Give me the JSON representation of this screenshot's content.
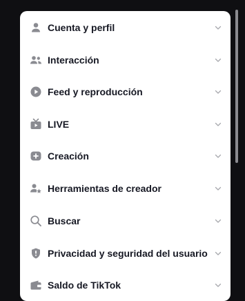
{
  "menu": {
    "items": [
      {
        "label": "Cuenta y perfil",
        "icon": "person-icon"
      },
      {
        "label": "Interacción",
        "icon": "people-icon"
      },
      {
        "label": "Feed y reproducción",
        "icon": "play-circle-icon"
      },
      {
        "label": "LIVE",
        "icon": "live-tv-icon"
      },
      {
        "label": "Creación",
        "icon": "plus-circle-icon"
      },
      {
        "label": "Herramientas de creador",
        "icon": "creator-star-icon"
      },
      {
        "label": "Buscar",
        "icon": "search-icon"
      },
      {
        "label": "Privacidad y seguridad del usuario",
        "icon": "shield-icon"
      },
      {
        "label": "Saldo de TikTok",
        "icon": "wallet-icon"
      }
    ]
  },
  "colors": {
    "icon": "#8a8b91",
    "text": "#161823",
    "chevron": "#a7a8ad",
    "background": "#0f0f12",
    "panel": "#ffffff"
  }
}
